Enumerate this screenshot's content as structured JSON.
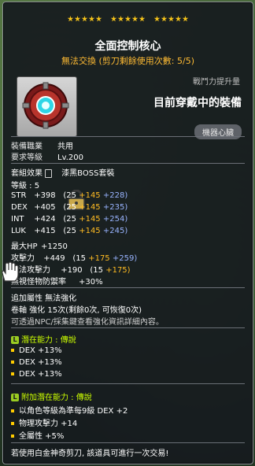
{
  "stars": {
    "groups": 3,
    "per_group": 5,
    "color": "#f4c21a"
  },
  "title": "全面控制核心",
  "subtitle": "無法交換 (剪刀剩餘使用次數: 5/5)",
  "item_icons": [
    "gear-core-icon",
    "lock-icon"
  ],
  "power_label": "戰鬥力提升量",
  "wearing_text": "目前穿戴中的裝備",
  "category": "機器心臟",
  "req": {
    "job_label": "裝備職業",
    "job_value": "共用",
    "level_label": "要求等級",
    "level_value": "Lv.200"
  },
  "set": {
    "label": "套組效果",
    "value": "漆黑BOSS套裝"
  },
  "level": {
    "label": "等級 : 5"
  },
  "stats": [
    {
      "name": "STR",
      "total": "+398",
      "base": "(25",
      "bonus": "+145",
      "extra": "+228)"
    },
    {
      "name": "DEX",
      "total": "+405",
      "base": "(25",
      "bonus": "+145",
      "extra": "+235)"
    },
    {
      "name": "INT",
      "total": "+424",
      "base": "(25",
      "bonus": "+145",
      "extra": "+254)"
    },
    {
      "name": "LUK",
      "total": "+415",
      "base": "(25",
      "bonus": "+145",
      "extra": "+245)"
    }
  ],
  "hp": {
    "label": "最大HP",
    "value": "+1250"
  },
  "atk": {
    "label": "攻擊力",
    "total": "+449",
    "base": "(15",
    "bonus": "+175",
    "extra": "+259)"
  },
  "matk": {
    "label": "魔法攻擊力",
    "total": "+190",
    "base": "(15",
    "bonus": "+175)"
  },
  "ignore_def": {
    "label": "無視怪物防禦率",
    "value": "+30%"
  },
  "extra_attr": "追加屬性 無法強化",
  "scroll": "卷軸 強化 15次(剩餘0次, 可恢復0次)",
  "npc_note": "可透過NPC/採集鍵查看強化資訊詳細內容。",
  "potential": {
    "header": "潛在能力 : 傳說",
    "lines": [
      "DEX +13%",
      "DEX +13%",
      "DEX +13%"
    ]
  },
  "additional": {
    "header": "附加潛在能力 : 傳說",
    "lines": [
      "以角色等級為準每9級 DEX +2",
      "物理攻擊力 +14",
      "全屬性 +5%"
    ]
  },
  "footer": "若使用白金神奇剪刀, 該道具可進行一次交易!"
}
